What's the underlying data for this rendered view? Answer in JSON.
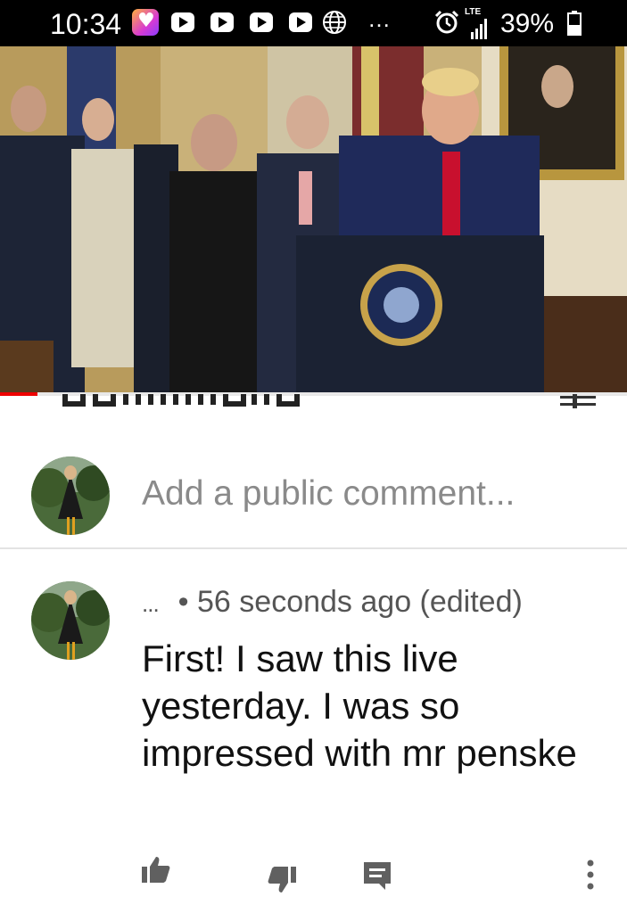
{
  "status_bar": {
    "time": "10:34",
    "network": "LTE",
    "battery": "39%",
    "overflow_dots": "…"
  },
  "video": {
    "progress_fraction": 0.06,
    "progress_color": "#ee0000"
  },
  "add_comment": {
    "placeholder": "Add a public comment..."
  },
  "comments": [
    {
      "author": "...",
      "timestamp": "• 56 seconds ago (edited)",
      "body": "First! I saw this live yesterday. I was so impressed with mr penske"
    }
  ],
  "icons": {
    "like": "thumb-up-icon",
    "dislike": "thumb-down-icon",
    "reply": "reply-icon",
    "more": "more-vertical-icon"
  }
}
